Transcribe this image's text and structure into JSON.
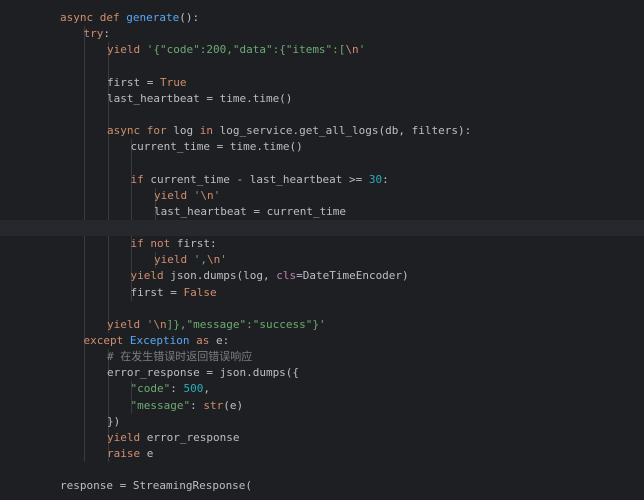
{
  "editor": {
    "language": "python",
    "theme": "dark",
    "lines": [
      {
        "indent": 0,
        "tokens": [
          {
            "t": "async def ",
            "c": "kw"
          },
          {
            "t": "generate",
            "c": "fn"
          },
          {
            "t": "():",
            "c": "plain"
          }
        ]
      },
      {
        "indent": 1,
        "tokens": [
          {
            "t": "try",
            "c": "kw"
          },
          {
            "t": ":",
            "c": "plain"
          }
        ]
      },
      {
        "indent": 2,
        "tokens": [
          {
            "t": "yield ",
            "c": "kw"
          },
          {
            "t": "'{\"code\":200,\"data\":{\"items\":[",
            "c": "str"
          },
          {
            "t": "\\n",
            "c": "esc"
          },
          {
            "t": "'",
            "c": "str"
          }
        ]
      },
      {
        "indent": 0,
        "tokens": []
      },
      {
        "indent": 2,
        "tokens": [
          {
            "t": "first = ",
            "c": "plain"
          },
          {
            "t": "True",
            "c": "kw"
          }
        ]
      },
      {
        "indent": 2,
        "tokens": [
          {
            "t": "last_heartbeat = time.time()",
            "c": "plain"
          }
        ]
      },
      {
        "indent": 0,
        "tokens": []
      },
      {
        "indent": 2,
        "tokens": [
          {
            "t": "async for ",
            "c": "kw"
          },
          {
            "t": "log ",
            "c": "plain"
          },
          {
            "t": "in ",
            "c": "kw"
          },
          {
            "t": "log_service.get_all_logs(db, filters):",
            "c": "plain"
          }
        ]
      },
      {
        "indent": 3,
        "tokens": [
          {
            "t": "current_time = time.time()",
            "c": "plain"
          }
        ]
      },
      {
        "indent": 0,
        "tokens": []
      },
      {
        "indent": 3,
        "tokens": [
          {
            "t": "if ",
            "c": "kw"
          },
          {
            "t": "current_time - last_heartbeat >= ",
            "c": "plain"
          },
          {
            "t": "30",
            "c": "num"
          },
          {
            "t": ":",
            "c": "plain"
          }
        ]
      },
      {
        "indent": 4,
        "tokens": [
          {
            "t": "yield ",
            "c": "kw"
          },
          {
            "t": "'",
            "c": "str"
          },
          {
            "t": "\\n",
            "c": "esc"
          },
          {
            "t": "'",
            "c": "str"
          }
        ]
      },
      {
        "indent": 4,
        "tokens": [
          {
            "t": "last_heartbeat = current_time",
            "c": "plain"
          }
        ]
      },
      {
        "indent": 0,
        "tokens": [],
        "current": true
      },
      {
        "indent": 3,
        "tokens": [
          {
            "t": "if not ",
            "c": "kw"
          },
          {
            "t": "first:",
            "c": "plain"
          }
        ]
      },
      {
        "indent": 4,
        "tokens": [
          {
            "t": "yield ",
            "c": "kw"
          },
          {
            "t": "',",
            "c": "str"
          },
          {
            "t": "\\n",
            "c": "esc"
          },
          {
            "t": "'",
            "c": "str"
          }
        ]
      },
      {
        "indent": 3,
        "tokens": [
          {
            "t": "yield ",
            "c": "kw"
          },
          {
            "t": "json.dumps(log, ",
            "c": "plain"
          },
          {
            "t": "cls",
            "c": "param"
          },
          {
            "t": "=DateTimeEncoder)",
            "c": "plain"
          }
        ]
      },
      {
        "indent": 3,
        "tokens": [
          {
            "t": "first = ",
            "c": "plain"
          },
          {
            "t": "False",
            "c": "kw"
          }
        ]
      },
      {
        "indent": 0,
        "tokens": []
      },
      {
        "indent": 2,
        "tokens": [
          {
            "t": "yield ",
            "c": "kw"
          },
          {
            "t": "'",
            "c": "str"
          },
          {
            "t": "\\n",
            "c": "esc"
          },
          {
            "t": "]},\"message\":\"success\"}'",
            "c": "str"
          }
        ]
      },
      {
        "indent": 1,
        "tokens": [
          {
            "t": "except ",
            "c": "kw"
          },
          {
            "t": "Exception",
            "c": "cls"
          },
          {
            "t": " as ",
            "c": "kw"
          },
          {
            "t": "e:",
            "c": "plain"
          }
        ]
      },
      {
        "indent": 2,
        "tokens": [
          {
            "t": "# 在发生错误时返回错误响应",
            "c": "cmt"
          }
        ]
      },
      {
        "indent": 2,
        "tokens": [
          {
            "t": "error_response = json.dumps({",
            "c": "plain"
          }
        ]
      },
      {
        "indent": 3,
        "tokens": [
          {
            "t": "\"code\"",
            "c": "str"
          },
          {
            "t": ": ",
            "c": "plain"
          },
          {
            "t": "500",
            "c": "num"
          },
          {
            "t": ",",
            "c": "plain"
          }
        ]
      },
      {
        "indent": 3,
        "tokens": [
          {
            "t": "\"message\"",
            "c": "str"
          },
          {
            "t": ": ",
            "c": "plain"
          },
          {
            "t": "str",
            "c": "kw"
          },
          {
            "t": "(e)",
            "c": "plain"
          }
        ]
      },
      {
        "indent": 2,
        "tokens": [
          {
            "t": "})",
            "c": "plain"
          }
        ]
      },
      {
        "indent": 2,
        "tokens": [
          {
            "t": "yield ",
            "c": "kw"
          },
          {
            "t": "error_response",
            "c": "plain"
          }
        ]
      },
      {
        "indent": 2,
        "tokens": [
          {
            "t": "raise ",
            "c": "kw"
          },
          {
            "t": "e",
            "c": "plain"
          }
        ]
      },
      {
        "indent": 0,
        "tokens": []
      },
      {
        "indent": 0,
        "tokens": [
          {
            "t": "response = StreamingResponse(",
            "c": "plain"
          }
        ]
      }
    ]
  }
}
